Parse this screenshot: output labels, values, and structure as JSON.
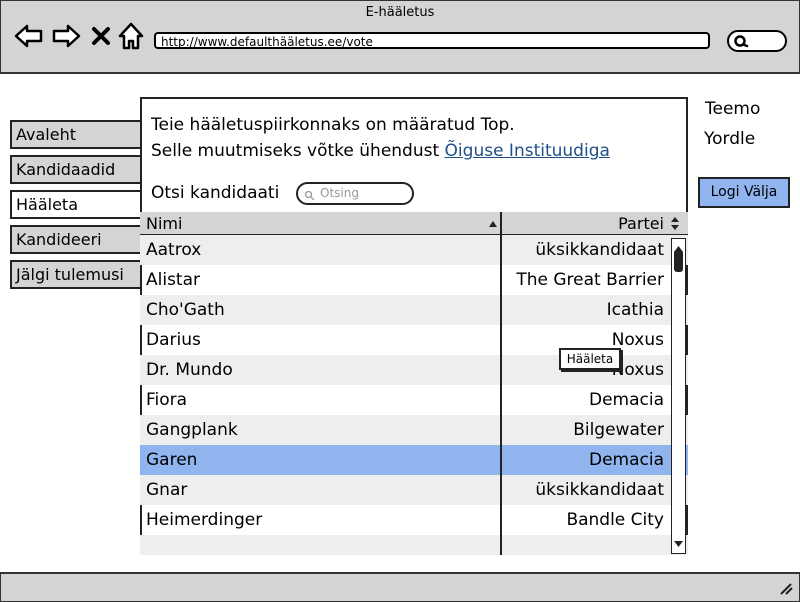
{
  "window": {
    "title": "E-hääletus"
  },
  "browser": {
    "url": "http://www.defaulthääletus.ee/vote",
    "icons": [
      "back-arrow-icon",
      "forward-arrow-icon",
      "close-icon",
      "home-icon",
      "search-icon"
    ]
  },
  "sidebar": {
    "items": [
      {
        "label": "Avaleht"
      },
      {
        "label": "Kandidaadid"
      },
      {
        "label": "Hääleta",
        "active": true
      },
      {
        "label": "Kandideeri"
      },
      {
        "label": "Jälgi tulemusi"
      }
    ]
  },
  "main": {
    "info_line1": "Teie hääletuspiirkonnaks on määratud Top.",
    "info_line2_prefix": "Selle muutmiseks võtke ühendust ",
    "info_link": "Õiguse Instituudiga",
    "search_label": "Otsi kandidaati",
    "search_placeholder": "Otsing",
    "table": {
      "col_name": "Nimi",
      "col_party": "Partei",
      "rows": [
        {
          "name": "Aatrox",
          "party": "üksikkandidaat"
        },
        {
          "name": "Alistar",
          "party": "The Great Barrier"
        },
        {
          "name": "Cho'Gath",
          "party": "Icathia"
        },
        {
          "name": "Darius",
          "party": "Noxus"
        },
        {
          "name": "Dr. Mundo",
          "party": "Noxus"
        },
        {
          "name": "Fiora",
          "party": "Demacia"
        },
        {
          "name": "Gangplank",
          "party": "Bilgewater"
        },
        {
          "name": "Garen",
          "party": "Demacia",
          "selected": true
        },
        {
          "name": "Gnar",
          "party": "üksikkandidaat"
        },
        {
          "name": "Heimerdinger",
          "party": "Bandle City"
        }
      ]
    },
    "vote_tooltip": "Hääleta"
  },
  "user": {
    "name": "Teemo",
    "region": "Yordle",
    "logout_label": "Logi Välja"
  },
  "colors": {
    "chrome": "#d4d4d4",
    "accent": "#8fb4ee",
    "link": "#1f4f86"
  }
}
